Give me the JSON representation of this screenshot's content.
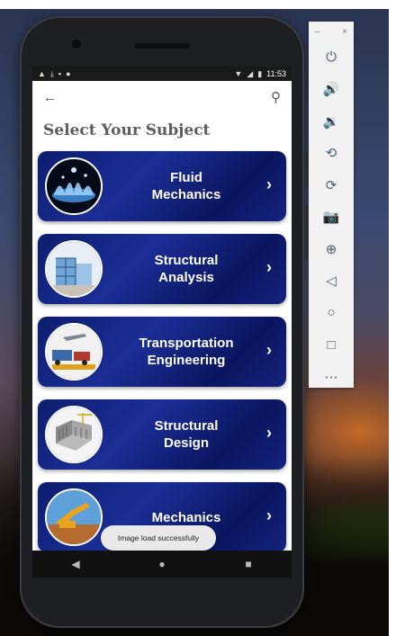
{
  "statusbar": {
    "time": "11:53",
    "left_icons": [
      "warning-icon",
      "download-icon",
      "sd-card-icon",
      "notification-dot-icon"
    ],
    "right_icons": [
      "wifi-icon",
      "signal-icon",
      "battery-icon"
    ]
  },
  "appbar": {
    "back_glyph": "←",
    "search_glyph": "⚲"
  },
  "page": {
    "title": "Select Your Subject"
  },
  "subjects": [
    {
      "line1": "Fluid",
      "line2": "Mechanics",
      "icon": "water-splash-image"
    },
    {
      "line1": "Structural",
      "line2": "Analysis",
      "icon": "building-frame-image"
    },
    {
      "line1": "Transportation",
      "line2": "Engineering",
      "icon": "transport-vehicles-image"
    },
    {
      "line1": "Structural",
      "line2": "Design",
      "icon": "building-model-image"
    },
    {
      "line1": "",
      "line2": "Mechanics",
      "icon": "excavator-image"
    }
  ],
  "chevron_glyph": "›",
  "toast": {
    "message": "Image load successfully"
  },
  "navbar": {
    "back": "◀",
    "home": "●",
    "recents": "■"
  },
  "emulator_toolbar": {
    "minimize": "–",
    "close": "×",
    "items": [
      {
        "name": "power-icon",
        "glyph": "⏻"
      },
      {
        "name": "volume-up-icon",
        "glyph": "🔊"
      },
      {
        "name": "volume-down-icon",
        "glyph": "🔉"
      },
      {
        "name": "rotate-left-icon",
        "glyph": "⟲"
      },
      {
        "name": "rotate-right-icon",
        "glyph": "⟳"
      },
      {
        "name": "camera-icon",
        "glyph": "📷"
      },
      {
        "name": "zoom-icon",
        "glyph": "⊕"
      },
      {
        "name": "back-icon",
        "glyph": "◁"
      },
      {
        "name": "home-icon",
        "glyph": "○"
      },
      {
        "name": "overview-icon",
        "glyph": "□"
      },
      {
        "name": "more-icon",
        "glyph": "⋯"
      }
    ]
  },
  "colors": {
    "card_dark": "#0a1660",
    "card_light": "#1b2e96",
    "title_gray": "#5d5d5d",
    "emulator_icon": "#4a5d73"
  }
}
